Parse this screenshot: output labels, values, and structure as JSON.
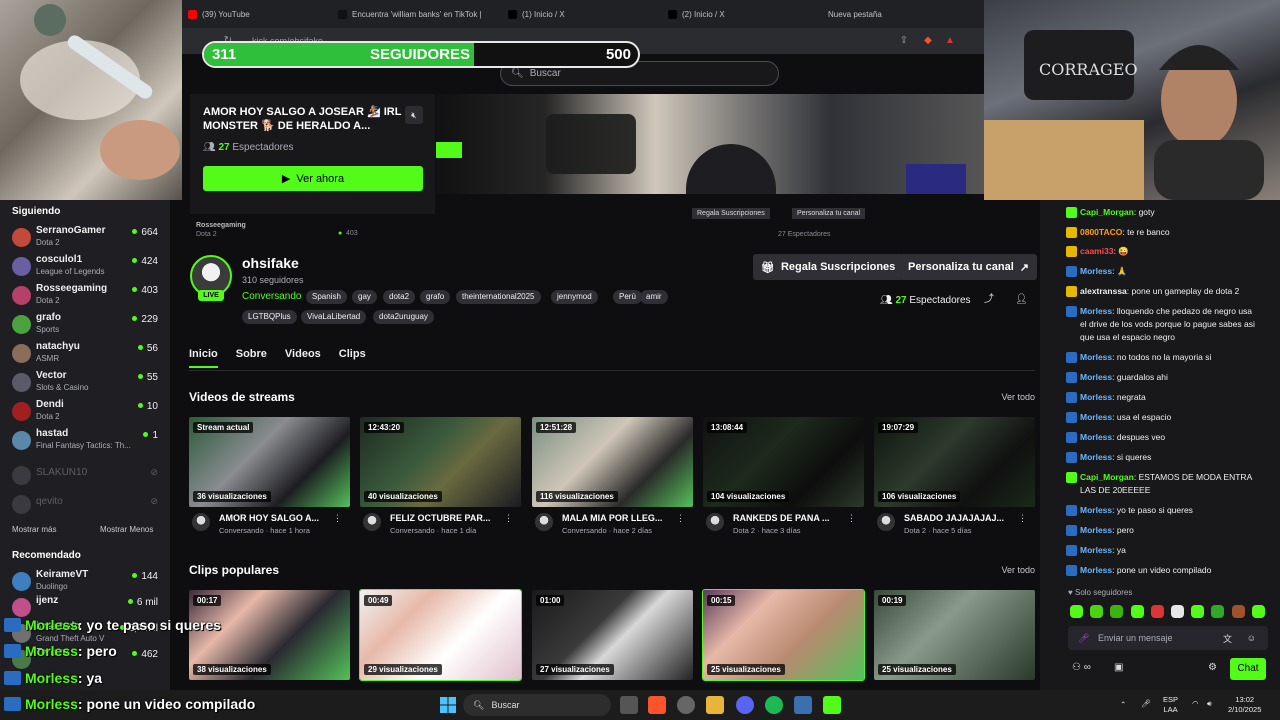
{
  "browser": {
    "tabs": [
      {
        "label": "(39) YouTube",
        "icon": "youtube-icon"
      },
      {
        "label": "Encuentra 'william banks' en TikTok |",
        "icon": "tiktok-icon"
      },
      {
        "label": "(1) Inicio / X",
        "icon": "x-icon"
      },
      {
        "label": "(2) Inicio / X",
        "icon": "x-icon"
      },
      {
        "label": "Nueva pestaña",
        "icon": ""
      }
    ],
    "url": "kick.com/ohsifake"
  },
  "followers_goal": {
    "current": "311",
    "label": "SEGUIDORES",
    "target": "500",
    "progress": 0.622
  },
  "search": {
    "placeholder": "Buscar"
  },
  "promo": {
    "title": "AMOR HOY SALGO A JOSEAR 🏂 IRL MONSTER 🐕 DE HERALDO A...",
    "viewers": "27",
    "viewers_label": "Espectadores",
    "watch_label": "Ver ahora"
  },
  "ghost": {
    "name": "Rosseegaming",
    "cat": "Dota 2",
    "count": "403",
    "btn1": "Regala Suscripciones",
    "btn2": "Personaliza tu canal",
    "viewers": "27 Espectadores"
  },
  "sidebar": {
    "following_title": "Siguiendo",
    "following": [
      {
        "name": "SerranoGamer",
        "category": "Dota 2",
        "count": "664",
        "color": "#c24a3a"
      },
      {
        "name": "cosculol1",
        "category": "League of Legends",
        "count": "424",
        "color": "#6a5fa3"
      },
      {
        "name": "Rosseegaming",
        "category": "Dota 2",
        "count": "403",
        "color": "#b5406a"
      },
      {
        "name": "grafo",
        "category": "Sports",
        "count": "229",
        "color": "#4aa33e"
      },
      {
        "name": "natachyu",
        "category": "ASMR",
        "count": "56",
        "color": "#8a6d5a"
      },
      {
        "name": "Vector",
        "category": "Slots & Casino",
        "count": "55",
        "color": "#5a5a6a"
      },
      {
        "name": "Dendi",
        "category": "Dota 2",
        "count": "10",
        "color": "#a02020"
      },
      {
        "name": "hastad",
        "category": "Final Fantasy Tactics: Th...",
        "count": "1",
        "color": "#5a88a8"
      }
    ],
    "offline": [
      {
        "name": "SLAKUN10"
      },
      {
        "name": "qevito"
      }
    ],
    "show_more": "Mostrar más",
    "show_less": "Mostrar Menos",
    "recommended_title": "Recomendado",
    "recommended": [
      {
        "name": "KeirameVT",
        "category": "Duolingo",
        "count": "144",
        "color": "#3f7fbf"
      },
      {
        "name": "ijenz",
        "category": "",
        "count": "6 mil",
        "color": "#c0508a"
      },
      {
        "name": "imantado",
        "category": "Grand Theft Auto V",
        "count": "2,7 mil",
        "color": "#707070"
      },
      {
        "name": "Tencru",
        "category": "",
        "count": "462",
        "color": "#4a7a4a"
      }
    ]
  },
  "channel": {
    "name": "ohsifake",
    "followers": "310 seguidores",
    "live": "LIVE",
    "category": "Conversando",
    "tags": [
      "Spanish",
      "gay",
      "dota2",
      "grafo",
      "theinternational2025",
      "jennymod",
      "Perù",
      "amir",
      "LGTBQPlus",
      "VivaLaLibertad",
      "dota2uruguay"
    ],
    "gift_label": "Regala Suscripciones",
    "customize_label": "Personaliza tu canal",
    "viewers": "27",
    "viewers_label": "Espectadores"
  },
  "tabs": [
    "Inicio",
    "Sobre",
    "Videos",
    "Clips"
  ],
  "videos_section": {
    "title": "Videos de streams",
    "see_all": "Ver todo",
    "items": [
      {
        "badge": "Stream actual",
        "views": "36 visualizaciones",
        "title": "AMOR HOY SALGO A...",
        "sub": "Conversando · hace 1 hora"
      },
      {
        "badge": "12:43:20",
        "views": "40 visualizaciones",
        "title": "FELIZ OCTUBRE PAR...",
        "sub": "Conversando · hace 1 día"
      },
      {
        "badge": "12:51:28",
        "views": "116 visualizaciones",
        "title": "MALA MIA POR LLEG...",
        "sub": "Conversando · hace 2 días"
      },
      {
        "badge": "13:08:44",
        "views": "104 visualizaciones",
        "title": "RANKEDS DE PANA ...",
        "sub": "Dota 2 · hace 3 días"
      },
      {
        "badge": "19:07:29",
        "views": "106 visualizaciones",
        "title": "SABADO JAJAJAJAJ...",
        "sub": "Dota 2 · hace 5 días"
      }
    ]
  },
  "clips_section": {
    "title": "Clips populares",
    "see_all": "Ver todo",
    "items": [
      {
        "badge": "00:17",
        "views": "38 visualizaciones"
      },
      {
        "badge": "00:49",
        "views": "29 visualizaciones"
      },
      {
        "badge": "01:00",
        "views": "27 visualizaciones"
      },
      {
        "badge": "00:15",
        "views": "25 visualizaciones"
      },
      {
        "badge": "00:19",
        "views": "25 visualizaciones"
      }
    ]
  },
  "chat": {
    "messages": [
      {
        "user": "Capi_Morgan",
        "text": "goty",
        "color": "#53fc18"
      },
      {
        "user": "0800TACO",
        "text": "te re banco",
        "color": "#ff9f1a"
      },
      {
        "user": "caami33",
        "text": "😜",
        "color": "#ff4b4b"
      },
      {
        "user": "Morless",
        "text": "🙏",
        "color": "#6bb7ff"
      },
      {
        "user": "alextranssa",
        "text": "pone un gameplay de dota 2",
        "color": "#efeff1"
      },
      {
        "user": "Morless",
        "text": "lloquendo che pedazo de negro usa el drive de los vods porque lo pague sabes asi que usa el espacio negro",
        "color": "#6bb7ff"
      },
      {
        "user": "Morless",
        "text": "no todos no la mayoria si",
        "color": "#6bb7ff"
      },
      {
        "user": "Morless",
        "text": "guardalos ahi",
        "color": "#6bb7ff"
      },
      {
        "user": "Morless",
        "text": "negrata",
        "color": "#6bb7ff"
      },
      {
        "user": "Morless",
        "text": "usa el espacio",
        "color": "#6bb7ff"
      },
      {
        "user": "Morless",
        "text": "despues veo",
        "color": "#6bb7ff"
      },
      {
        "user": "Morless",
        "text": "si queres",
        "color": "#6bb7ff"
      },
      {
        "user": "Capi_Morgan",
        "text": "ESTAMOS DE MODA ENTRA LAS DE 20EEEEE",
        "color": "#53fc18"
      },
      {
        "user": "Morless",
        "text": "yo te paso si queres",
        "color": "#6bb7ff"
      },
      {
        "user": "Morless",
        "text": "pero",
        "color": "#6bb7ff"
      },
      {
        "user": "Morless",
        "text": "ya",
        "color": "#6bb7ff"
      },
      {
        "user": "Morless",
        "text": "pone un video compilado",
        "color": "#6bb7ff"
      }
    ],
    "followers_only": "Solo seguidores",
    "input_placeholder": "Enviar un mensaje",
    "send_label": "Chat"
  },
  "overlay_chat": [
    {
      "user": "Morless",
      "text": ": yo te paso si queres"
    },
    {
      "user": "Morless",
      "text": ": pero"
    },
    {
      "user": "Morless",
      "text": ": ya"
    },
    {
      "user": "Morless",
      "text": ": pone un video compilado"
    }
  ],
  "taskbar": {
    "search_label": "Buscar",
    "lang": "ESP",
    "region": "LAA",
    "time": "13:02",
    "date": "2/10/2025"
  }
}
